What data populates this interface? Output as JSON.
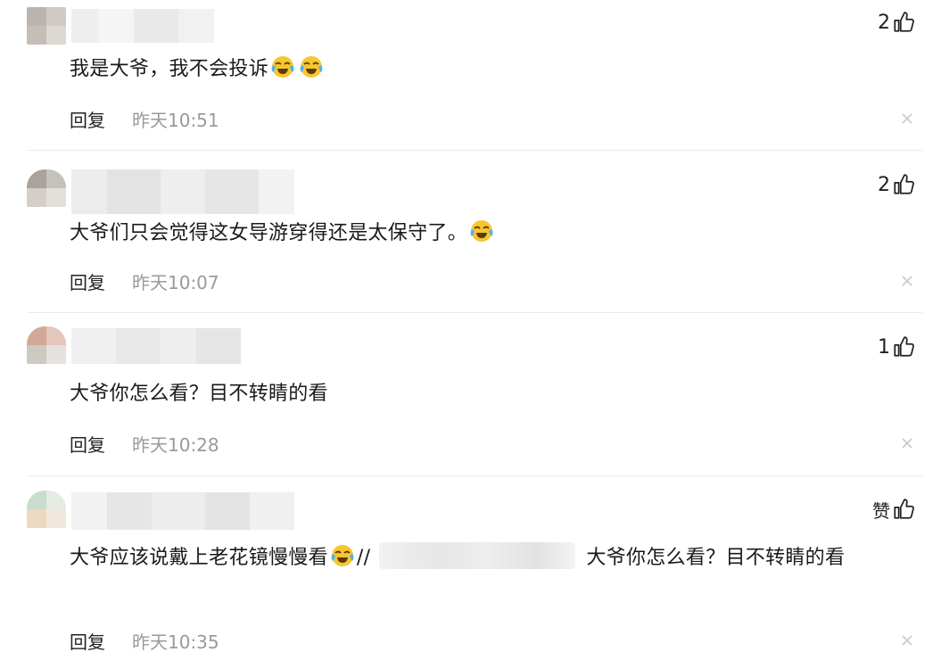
{
  "comments": [
    {
      "likes": "2",
      "text": "我是大爷，我不会投诉",
      "emoji_count": 2,
      "reply_label": "回复",
      "time": "昨天10:51",
      "close_icon": "close-icon"
    },
    {
      "likes": "2",
      "text": "大爷们只会觉得这女导游穿得还是太保守了。",
      "emoji_count": 1,
      "reply_label": "回复",
      "time": "昨天10:07",
      "close_icon": "close-icon"
    },
    {
      "likes": "1",
      "text": "大爷你怎么看？目不转睛的看",
      "emoji_count": 0,
      "reply_label": "回复",
      "time": "昨天10:28",
      "close_icon": "close-icon"
    },
    {
      "likes": "赞",
      "text_before": "大爷应该说戴上老花镜慢慢看",
      "text_slashes": "//",
      "text_after": "大爷你怎么看？目不转睛的看",
      "emoji_count": 1,
      "reply_label": "回复",
      "time": "昨天10:35",
      "close_icon": "close-icon"
    }
  ],
  "icons": {
    "like": "thumbs-up-icon",
    "emoji": "crying-laughing-emoji",
    "close": "close-icon"
  },
  "colors": {
    "time": "#9a9a9a",
    "text": "#1a1a1a",
    "divider": "#ececec"
  }
}
